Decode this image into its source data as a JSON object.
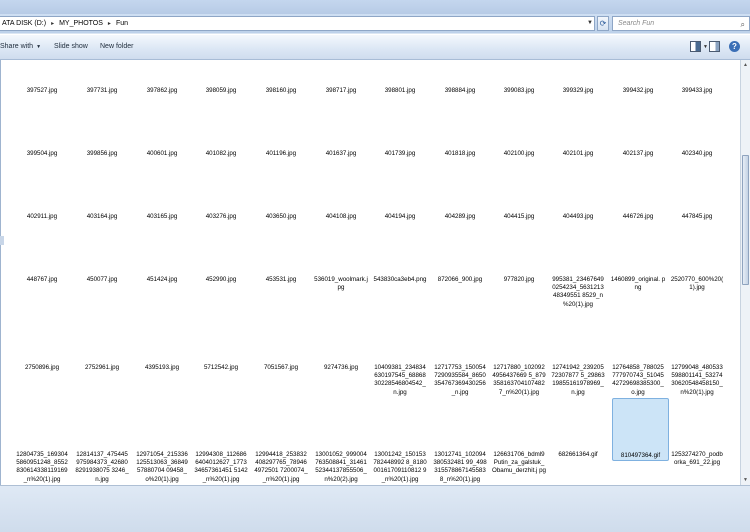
{
  "address": {
    "path": [
      "ATA DISK (D:)",
      "MY_PHOTOS",
      "Fun"
    ],
    "separator": "▸",
    "dropdown_icon": "chevron-down-icon",
    "refresh_icon": "refresh-icon"
  },
  "search": {
    "placeholder": "Search Fun",
    "icon": "search-icon"
  },
  "toolbar": {
    "share_label": "Share with",
    "slideshow_label": "Slide show",
    "newfolder_label": "New folder",
    "views_icon": "views-icon",
    "pane_icon": "preview-pane-icon",
    "help_icon": "help-icon",
    "help_glyph": "?"
  },
  "files": {
    "row1": [
      "397527.jpg",
      "397731.jpg",
      "397862.jpg",
      "398059.jpg",
      "398160.jpg",
      "398717.jpg",
      "398801.jpg",
      "398884.jpg",
      "399083.jpg",
      "399329.jpg",
      "399432.jpg",
      "399433.jpg"
    ],
    "row2": [
      "399504.jpg",
      "399856.jpg",
      "400601.jpg",
      "401082.jpg",
      "401196.jpg",
      "401637.jpg",
      "401739.jpg",
      "401818.jpg",
      "402100.jpg",
      "402101.jpg",
      "402137.jpg",
      "402340.jpg"
    ],
    "row3": [
      "402911.jpg",
      "403164.jpg",
      "403165.jpg",
      "403276.jpg",
      "403650.jpg",
      "404108.jpg",
      "404194.jpg",
      "404289.jpg",
      "404415.jpg",
      "404493.jpg",
      "446726.jpg",
      "447845.jpg"
    ],
    "row4": [
      "448767.jpg",
      "450077.jpg",
      "451424.jpg",
      "452990.jpg",
      "453531.jpg",
      "536019_woolmark.jpg",
      "543830ca3eb4.png",
      "872066_900.jpg",
      "977820.jpg",
      "995381_23467649 0254234_5631213 48349551 8529_n %20(1).jpg",
      "1460899_original. png",
      "2520770_600%20( 1).jpg"
    ],
    "row5": [
      "2750896.jpg",
      "2752961.jpg",
      "4395193.jpg",
      "5712542.jpg",
      "7051567.jpg",
      "9274736.jpg",
      "10409381_234834 630197545_68868 30228546804542_ n.jpg",
      "12717753_150054 7290935584_8650 354767369430256 _n.jpg",
      "12717880_102092 4956437669 5_879 358163704107482 7_n%20(1).jpg",
      "12741942_239205 72307877 5_29863 19855161978969_ n.jpg",
      "12764858_788025 777970743_51045 42729698385300_ o.jpg",
      "12799048_480533 598801141_53274 30620548458150_ n%20(1).jpg"
    ],
    "row6": [
      "12804735_169304 5860951248_8552 830614338119169 _n%20(1).jpg",
      "12814137_475445 975984373_42680 8291938075 3246_ n.jpg",
      "12971054_215336 125513063_36849 57880704 09458_ o%20(1).jpg",
      "12994308_112686 6404012627_1773 34657361451 5142 _n%20(1).jpg",
      "12994418_253832 408297765_78946 4972501 7200074_ _n%20(1).jpg",
      "13001052_999004 763508841_31461 52344137855506_ n%20(2).jpg",
      "13001242_150153 782448992 8_8180 00161709110812 9_n%20(1).jpg",
      "13012741_102094 380532481 99_498 315578867145583 8_n%20(1).jpg",
      "126631706_bdml9 Putin_za_galstuk_ Obamu_derzhit.j pg",
      "682661364.gif",
      "810497364.gif",
      "1253274270_podb orka_691_22.jpg"
    ]
  }
}
